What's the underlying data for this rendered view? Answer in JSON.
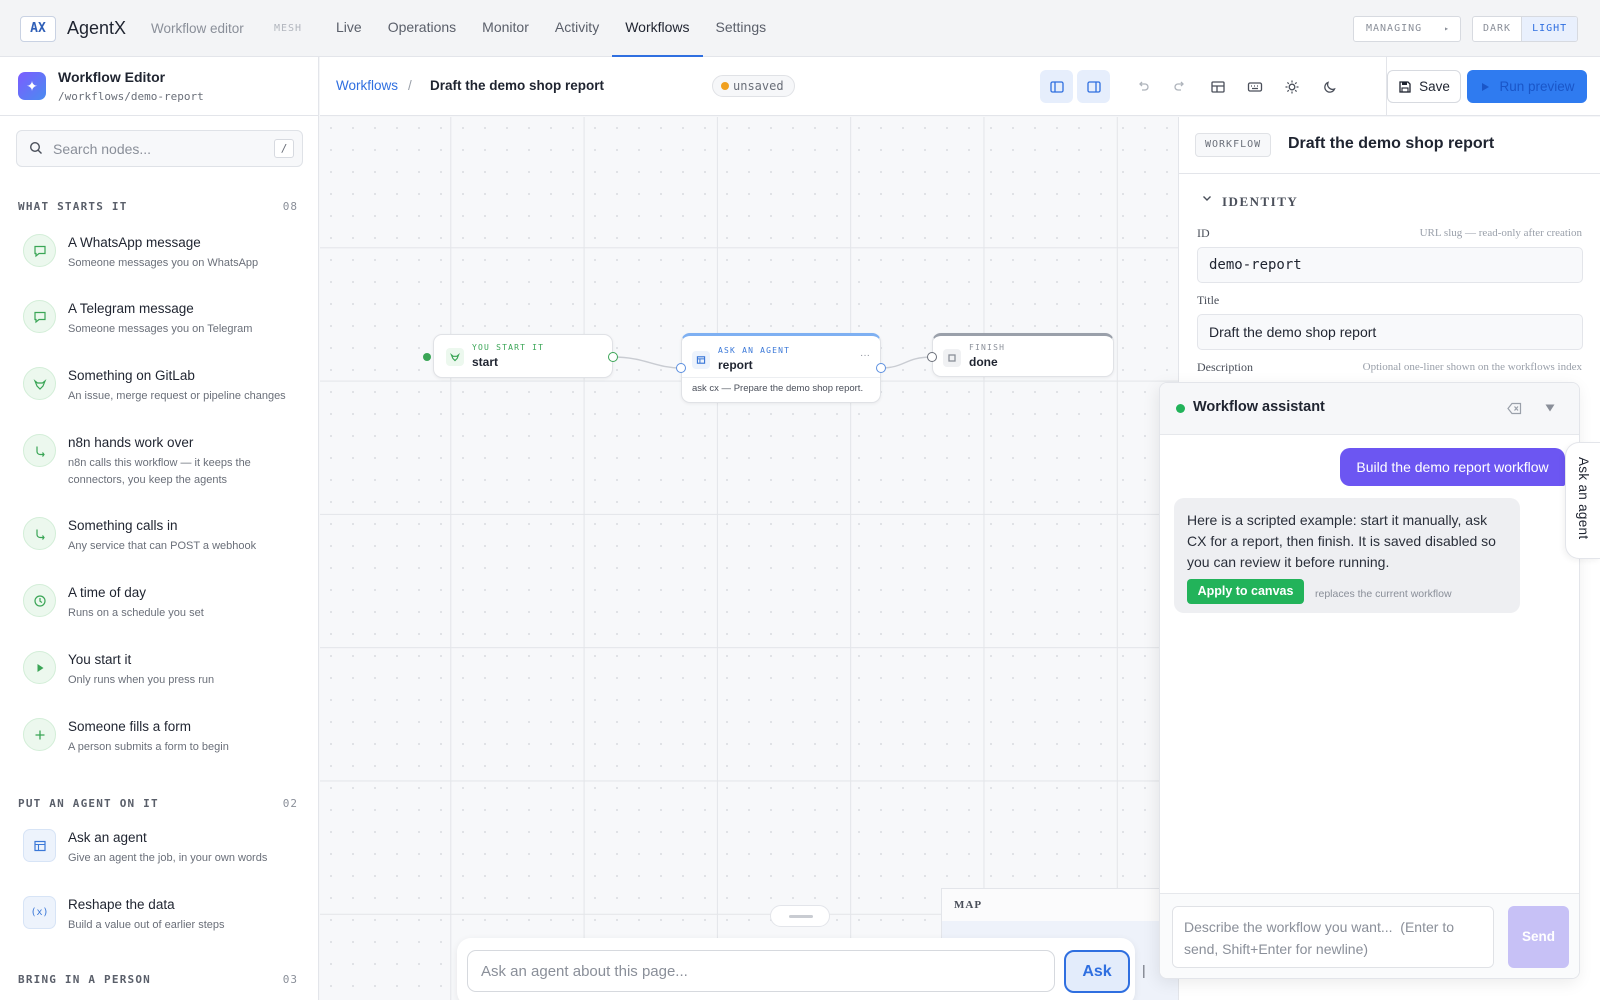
{
  "topbar": {
    "logo": "AX",
    "app_name": "AgentX",
    "page_label": "Workflow editor",
    "mesh": "MESH",
    "nav": [
      "Live",
      "Operations",
      "Monitor",
      "Activity",
      "Workflows",
      "Settings"
    ],
    "active_nav": "Workflows",
    "managing": "MANAGING",
    "theme_dark": "DARK",
    "theme_light": "LIGHT"
  },
  "sidebar": {
    "title": "Workflow Editor",
    "path": "/workflows/demo-report",
    "search_placeholder": "Search nodes...",
    "search_shortcut": "/",
    "sections": [
      {
        "label": "WHAT STARTS IT",
        "count": "08",
        "items": [
          {
            "title": "A WhatsApp message",
            "desc": "Someone messages you on WhatsApp",
            "icon": "chat-icon"
          },
          {
            "title": "A Telegram message",
            "desc": "Someone messages you on Telegram",
            "icon": "chat-icon"
          },
          {
            "title": "Something on GitLab",
            "desc": "An issue, merge request or pipeline changes",
            "icon": "gitlab-icon"
          },
          {
            "title": "n8n hands work over",
            "desc": "n8n calls this workflow — it keeps the connectors, you keep the agents",
            "icon": "hook-icon"
          },
          {
            "title": "Something calls in",
            "desc": "Any service that can POST a webhook",
            "icon": "hook-icon"
          },
          {
            "title": "A time of day",
            "desc": "Runs on a schedule you set",
            "icon": "clock-icon"
          },
          {
            "title": "You start it",
            "desc": "Only runs when you press run",
            "icon": "play-icon"
          },
          {
            "title": "Someone fills a form",
            "desc": "A person submits a form to begin",
            "icon": "plus-icon"
          }
        ]
      },
      {
        "label": "PUT AN AGENT ON IT",
        "count": "02",
        "items": [
          {
            "title": "Ask an agent",
            "desc": "Give an agent the job, in your own words",
            "icon": "agent-icon"
          },
          {
            "title": "Reshape the data",
            "desc": "Build a value out of earlier steps",
            "icon": "function-icon"
          }
        ]
      },
      {
        "label": "BRING IN A PERSON",
        "count": "03",
        "items": []
      }
    ]
  },
  "toolbar": {
    "crumb_root": "Workflows",
    "crumb_sep": "/",
    "crumb_current": "Draft the demo shop report",
    "status": "unsaved",
    "save_label": "Save",
    "run_label": "Run preview"
  },
  "canvas": {
    "nodes": [
      {
        "kind": "YOU START IT",
        "name": "start"
      },
      {
        "kind": "ASK AN AGENT",
        "name": "report",
        "detail": "ask cx — Prepare the demo shop report.",
        "more": "···"
      },
      {
        "kind": "FINISH",
        "name": "done"
      }
    ],
    "map_label": "MAP",
    "ask_placeholder": "Ask an agent about this page...",
    "ask_button": "Ask",
    "cursor": "|"
  },
  "props": {
    "badge": "WORKFLOW",
    "title": "Draft the demo shop report",
    "section": "IDENTITY",
    "id_label": "ID",
    "id_hint": "URL slug — read-only after creation",
    "id_value": "demo-report",
    "title_label": "Title",
    "title_value": "Draft the demo shop report",
    "desc_label": "Description",
    "desc_hint": "Optional one-liner shown on the workflows index"
  },
  "assistant": {
    "title": "Workflow assistant",
    "user_message": "Build the demo report workflow",
    "bot_message": "Here is a scripted example: start it manually, ask CX for a report, then finish. It is saved disabled so you can review it before running.",
    "apply_label": "Apply to canvas",
    "apply_note": "replaces the current workflow",
    "input_placeholder": "Describe the workflow you want...  (Enter to send, Shift+Enter for newline)",
    "send_label": "Send",
    "side_tab": "Ask an agent"
  },
  "colors": {
    "accent": "#2f6fe0",
    "purple": "#6c56f2",
    "success": "#22b35a",
    "warning": "#f0a020"
  }
}
